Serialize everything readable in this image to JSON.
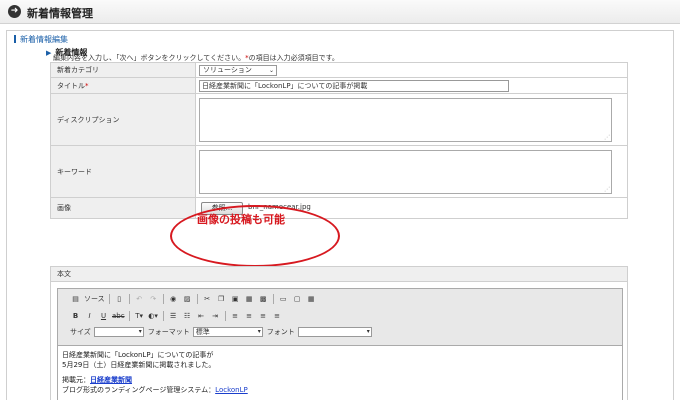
{
  "header": {
    "icon": "arrow-right-circle-icon",
    "title": "新着情報管理"
  },
  "panel": {
    "title": "新着情報編集",
    "instructions_pre": "編集内容を入力し、「次へ」ボタンをクリックしてください。",
    "req_mark": "*",
    "instructions_post": "の項目は入力必須項目です。"
  },
  "section": {
    "icon": "triangle-right-icon",
    "title": "新着情報"
  },
  "form": {
    "category_label": "新着カテゴリ",
    "category_value": "ソリューション",
    "title_label": "タイトル",
    "title_req": "*",
    "title_value": "日経産業新聞に「LockonLP」についての記事が掲載",
    "description_label": "ディスクリプション",
    "keyword_label": "キーワード",
    "image_label": "画像",
    "browse_label": "参照...",
    "filename": "bnr_namecear.jpg"
  },
  "callout": {
    "text": "画像の投稿も可能",
    "color": "#d71920"
  },
  "body": {
    "label": "本文",
    "toolbar": {
      "source_label": "ソース",
      "size_label": "サイズ",
      "format_label": "フォーマット",
      "format_value": "標準",
      "font_label": "フォント"
    },
    "content": {
      "line1": "日経産業新聞に「LockonLP」についての記事が",
      "line2": "5月29日（土）日経産業新聞に掲載されました。",
      "source_prefix": "掲載元：",
      "source_link": "日経産業新聞",
      "system_prefix": "ブログ形式のランディングページ管理システム：",
      "system_link": "LockonLP"
    }
  },
  "colors": {
    "accent": "#1a5fa8",
    "required": "#cc0000",
    "label_bg": "#efefef"
  }
}
